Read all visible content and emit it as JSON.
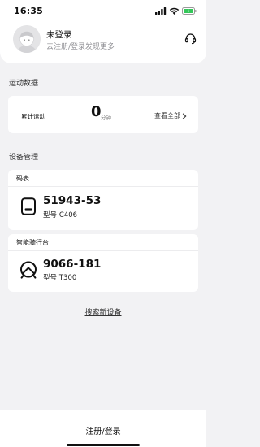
{
  "status_bar": {
    "time": "16:35"
  },
  "profile": {
    "name": "未登录",
    "subtitle": "去注册/登录发现更多",
    "support_icon": "headset-icon"
  },
  "sport": {
    "section_title": "运动数据",
    "label": "累计运动",
    "value": "0",
    "unit": "分钟",
    "view_all": "查看全部"
  },
  "devices": {
    "section_title": "设备管理",
    "items": [
      {
        "type": "码表",
        "icon": "bike-computer-icon",
        "id": "51943-53",
        "model": "型号:C406"
      },
      {
        "type": "智能骑行台",
        "icon": "smart-trainer-icon",
        "id": "9066-181",
        "model": "型号:T300"
      }
    ]
  },
  "search_new_device": "搜索新设备",
  "bottom_action": "注册/登录",
  "colors": {
    "background": "#f2f2f4",
    "card": "#ffffff",
    "battery": "#34c759",
    "secondary_text": "#8d8d92"
  }
}
